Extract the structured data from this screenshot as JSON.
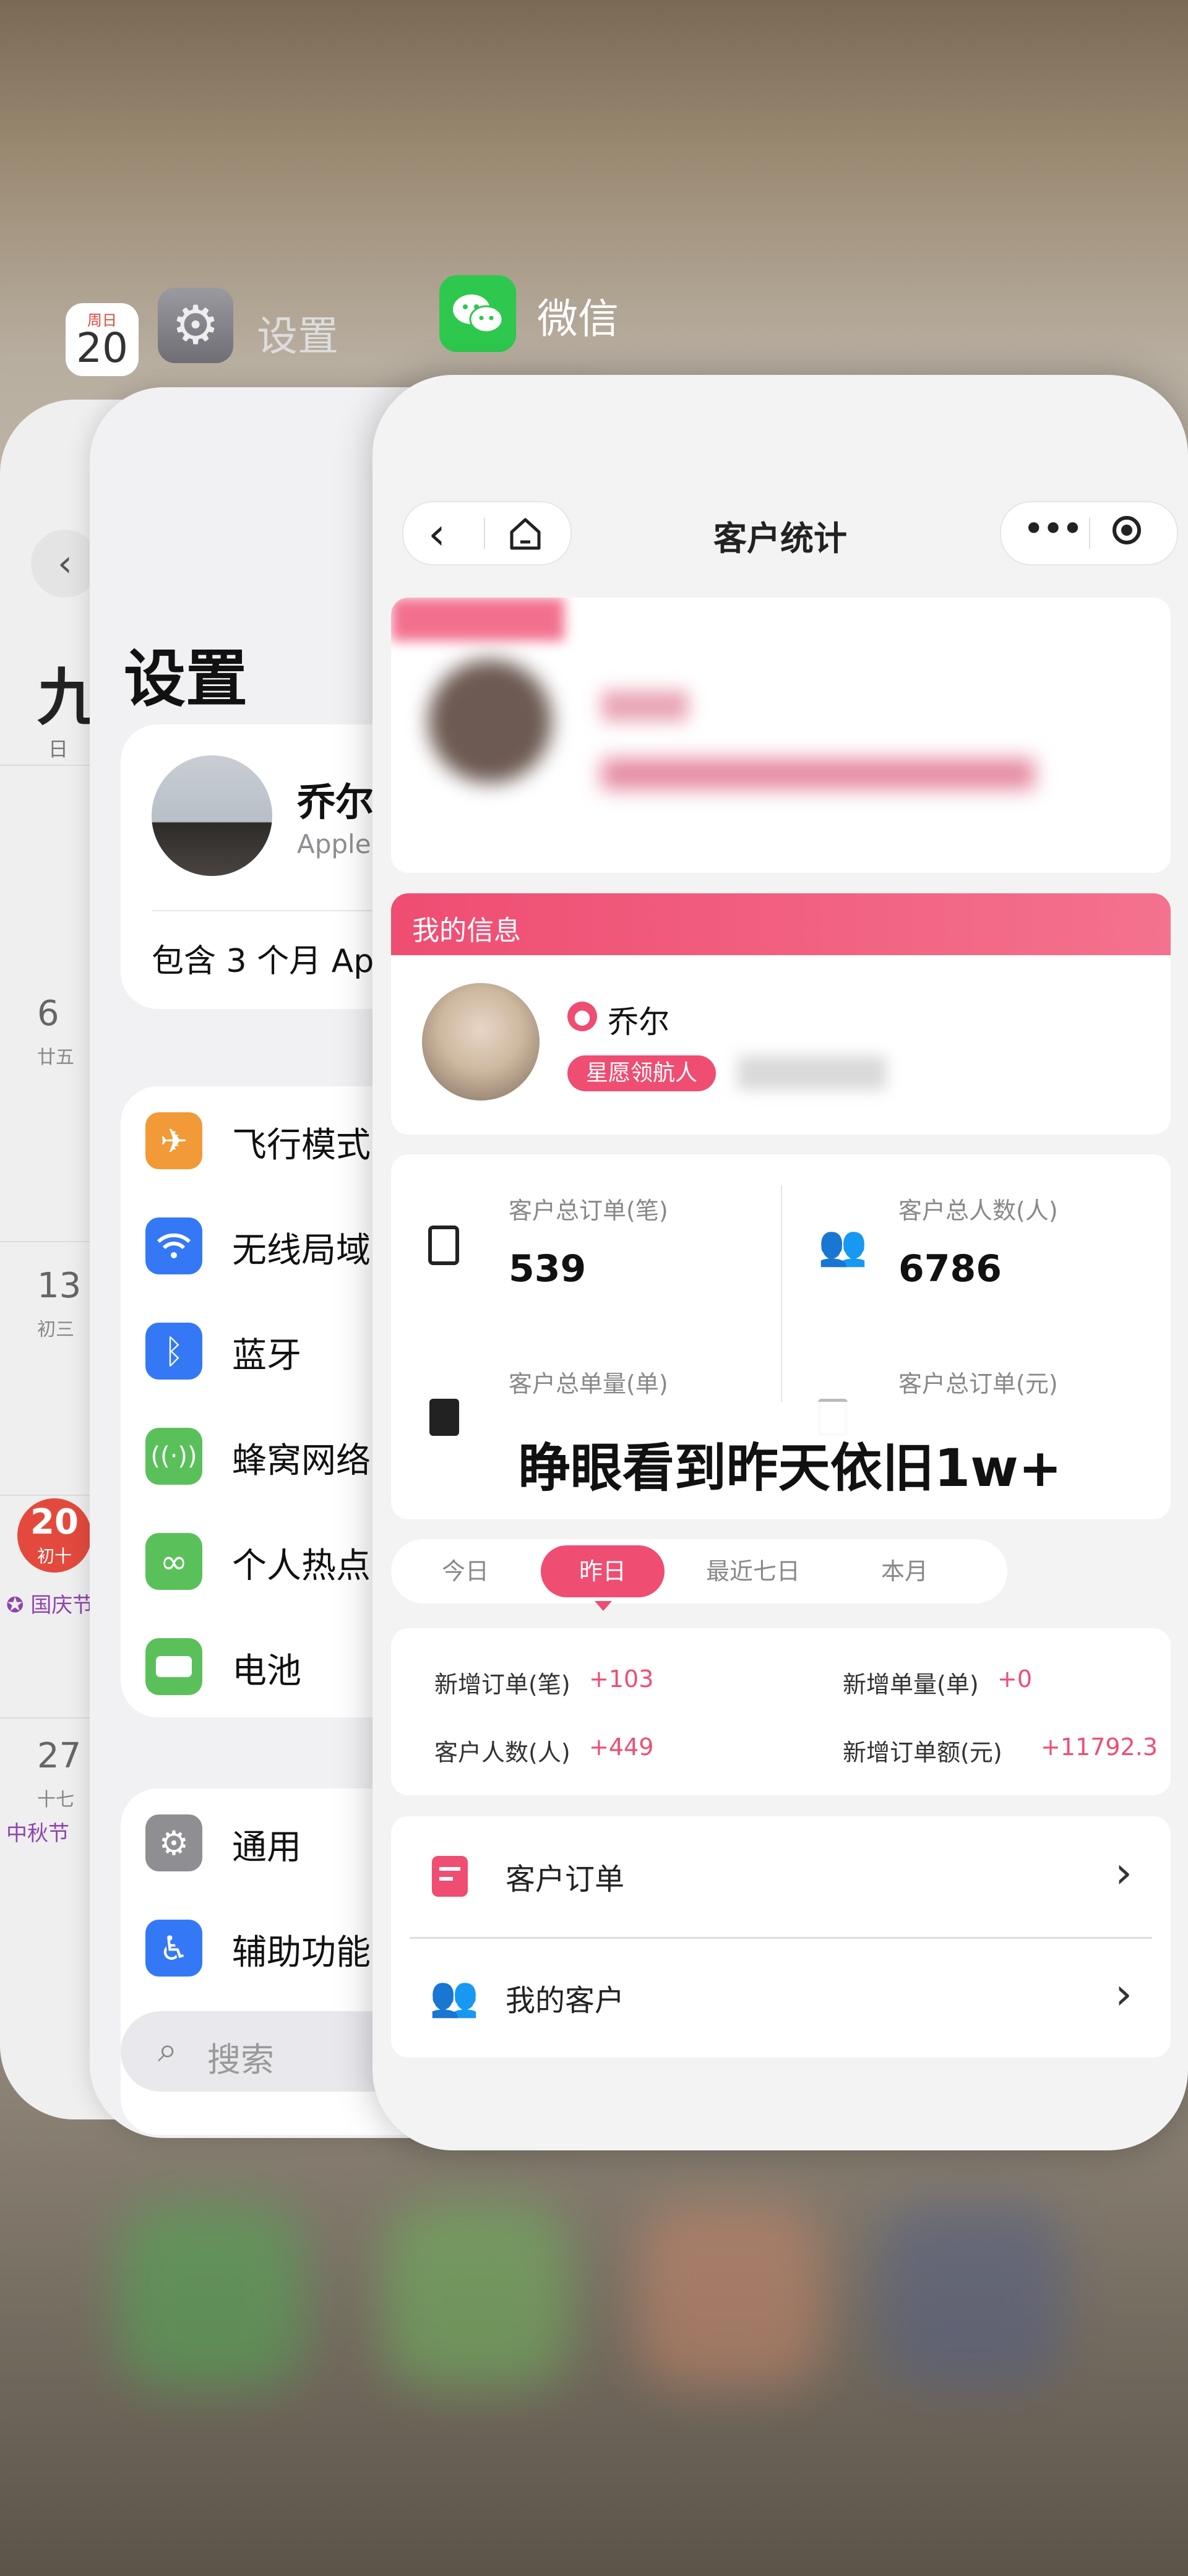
{
  "switcher": {
    "calendar_icon": {
      "weekday": "周日",
      "day": "20"
    },
    "settings_title": "设置",
    "wechat_title": "微信"
  },
  "calendar": {
    "month_char": "九",
    "weekday_header": "日",
    "rows": [
      {
        "date": "6",
        "lunar": "廿五"
      },
      {
        "date": "13",
        "lunar": "初三"
      },
      {
        "date": "20",
        "lunar": "初十",
        "holiday": "国庆节"
      },
      {
        "date": "27",
        "lunar": "十七",
        "holiday": "中秋节"
      }
    ]
  },
  "settings": {
    "title": "设置",
    "profile_name": "乔尔",
    "profile_sub": "Apple账",
    "promo": "包含 3 个月 Ap",
    "items_a": [
      {
        "label": "飞行模式",
        "icon": "airplane-icon",
        "color": "#f19a37"
      },
      {
        "label": "无线局域",
        "icon": "wifi-icon",
        "color": "#3478f6"
      },
      {
        "label": "蓝牙",
        "icon": "bluetooth-icon",
        "color": "#3478f6"
      },
      {
        "label": "蜂窝网络",
        "icon": "cellular-icon",
        "color": "#5ac15a"
      },
      {
        "label": "个人热点",
        "icon": "hotspot-icon",
        "color": "#5ac15a"
      },
      {
        "label": "电池",
        "icon": "battery-icon",
        "color": "#5ac15a"
      }
    ],
    "items_b": [
      {
        "label": "通用",
        "icon": "gear-icon",
        "color": "#8e8e93"
      },
      {
        "label": "辅助功能",
        "icon": "accessibility-icon",
        "color": "#3478f6"
      }
    ],
    "search_placeholder": "搜索"
  },
  "mini": {
    "title": "客户统计",
    "my_info_label": "我的信息",
    "user_name": "乔尔",
    "user_badge": "星愿领航人",
    "stats": [
      {
        "label": "客户总订单(笔)",
        "value": "539"
      },
      {
        "label": "客户总人数(人)",
        "value": "6786"
      },
      {
        "label": "客户总单量(单)",
        "value": ""
      },
      {
        "label": "客户总订单(元)",
        "value": ""
      }
    ],
    "overlay_caption": "睁眼看到昨天依旧1w+",
    "tabs": [
      "今日",
      "昨日",
      "最近七日",
      "本月"
    ],
    "active_tab_index": 1,
    "period": [
      {
        "label": "新增订单(笔)",
        "value": "+103"
      },
      {
        "label": "新增单量(单)",
        "value": "+0"
      },
      {
        "label": "客户人数(人)",
        "value": "+449"
      },
      {
        "label": "新增订单额(元)",
        "value": "+11792.3"
      }
    ],
    "menu": [
      {
        "label": "客户订单",
        "icon": "order-icon"
      },
      {
        "label": "我的客户",
        "icon": "customers-icon"
      }
    ],
    "accent": "#ef4d72"
  }
}
